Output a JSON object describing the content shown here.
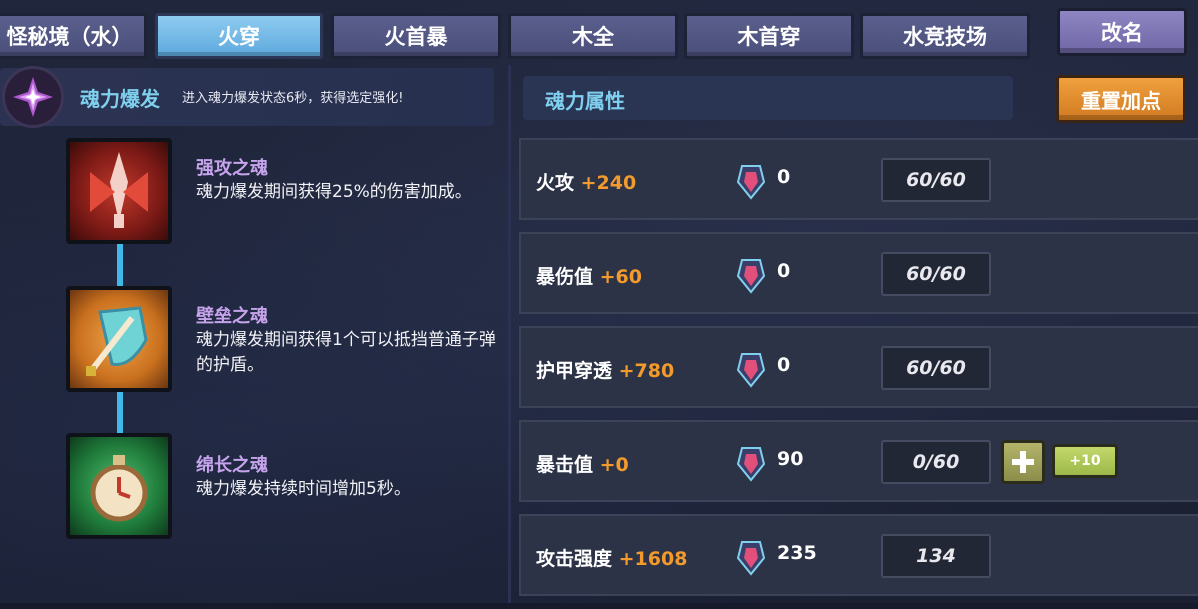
{
  "tabs": [
    {
      "label": "怪秘境（水）"
    },
    {
      "label": "火穿"
    },
    {
      "label": "火首暴"
    },
    {
      "label": "木全"
    },
    {
      "label": "木首穿"
    },
    {
      "label": "水竞技场"
    }
  ],
  "active_tab": "火穿",
  "rename_label": "改名",
  "burst": {
    "title": "魂力爆发",
    "desc": "进入魂力爆发状态6秒，获得选定强化!"
  },
  "skills": [
    {
      "name": "强攻之魂",
      "desc": "魂力爆发期间获得25%的伤害加成。",
      "icon": "red-winged-sword-icon"
    },
    {
      "name": "壁垒之魂",
      "desc": "魂力爆发期间获得1个可以抵挡普通子弹的护盾。",
      "icon": "shield-sword-icon"
    },
    {
      "name": "绵长之魂",
      "desc": "魂力爆发持续时间增加5秒。",
      "icon": "pocket-watch-icon"
    }
  ],
  "attributes": {
    "title": "魂力属性",
    "reset_label": "重置加点",
    "rows": [
      {
        "label": "火攻",
        "bonus": "+240",
        "gems": "0",
        "points": "60/60"
      },
      {
        "label": "暴伤值",
        "bonus": "+60",
        "gems": "0",
        "points": "60/60"
      },
      {
        "label": "护甲穿透",
        "bonus": "+780",
        "gems": "0",
        "points": "60/60"
      },
      {
        "label": "暴击值",
        "bonus": "+0",
        "gems": "90",
        "points": "0/60",
        "plus": "+",
        "plus10": "+10"
      },
      {
        "label": "攻击强度",
        "bonus": "+1608",
        "gems": "235",
        "points": "134"
      }
    ]
  },
  "colors": {
    "accent_blue": "#7fd0ee",
    "bonus_orange": "#f39a2c",
    "skill_purple": "#c6a4ec",
    "reset_orange": "#e08a2a",
    "active_tab": "#6fb6e4"
  }
}
